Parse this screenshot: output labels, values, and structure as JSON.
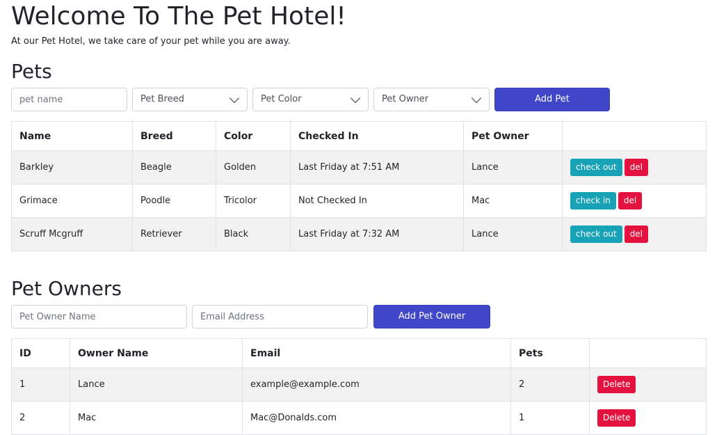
{
  "header": {
    "title": "Welcome To The Pet Hotel!",
    "subtitle": "At our Pet Hotel, we take care of your pet while you are away."
  },
  "pets": {
    "heading": "Pets",
    "form": {
      "name_placeholder": "pet name",
      "breed_select": "Pet Breed",
      "color_select": "Pet Color",
      "owner_select": "Pet Owner",
      "add_button": "Add Pet"
    },
    "columns": [
      "Name",
      "Breed",
      "Color",
      "Checked In",
      "Pet Owner",
      ""
    ],
    "rows": [
      {
        "name": "Barkley",
        "breed": "Beagle",
        "color": "Golden",
        "checked_in": "Last Friday at 7:51 AM",
        "owner": "Lance",
        "action": "check out",
        "delete": "del"
      },
      {
        "name": "Grimace",
        "breed": "Poodle",
        "color": "Tricolor",
        "checked_in": "Not Checked In",
        "owner": "Mac",
        "action": "check in",
        "delete": "del"
      },
      {
        "name": "Scruff Mcgruff",
        "breed": "Retriever",
        "color": "Black",
        "checked_in": "Last Friday at 7:32 AM",
        "owner": "Lance",
        "action": "check out",
        "delete": "del"
      }
    ]
  },
  "owners": {
    "heading": "Pet Owners",
    "form": {
      "name_placeholder": "Pet Owner Name",
      "email_placeholder": "Email Address",
      "add_button": "Add Pet Owner"
    },
    "columns": [
      "ID",
      "Owner Name",
      "Email",
      "Pets",
      ""
    ],
    "rows": [
      {
        "id": "1",
        "name": "Lance",
        "email": "example@example.com",
        "pets": "2",
        "delete": "Delete"
      },
      {
        "id": "2",
        "name": "Mac",
        "email": "Mac@Donalds.com",
        "pets": "1",
        "delete": "Delete"
      }
    ]
  },
  "colors": {
    "primary": "#4046c8",
    "info": "#17a2b8",
    "danger": "#e4123f",
    "stripe": "#f2f2f2"
  }
}
